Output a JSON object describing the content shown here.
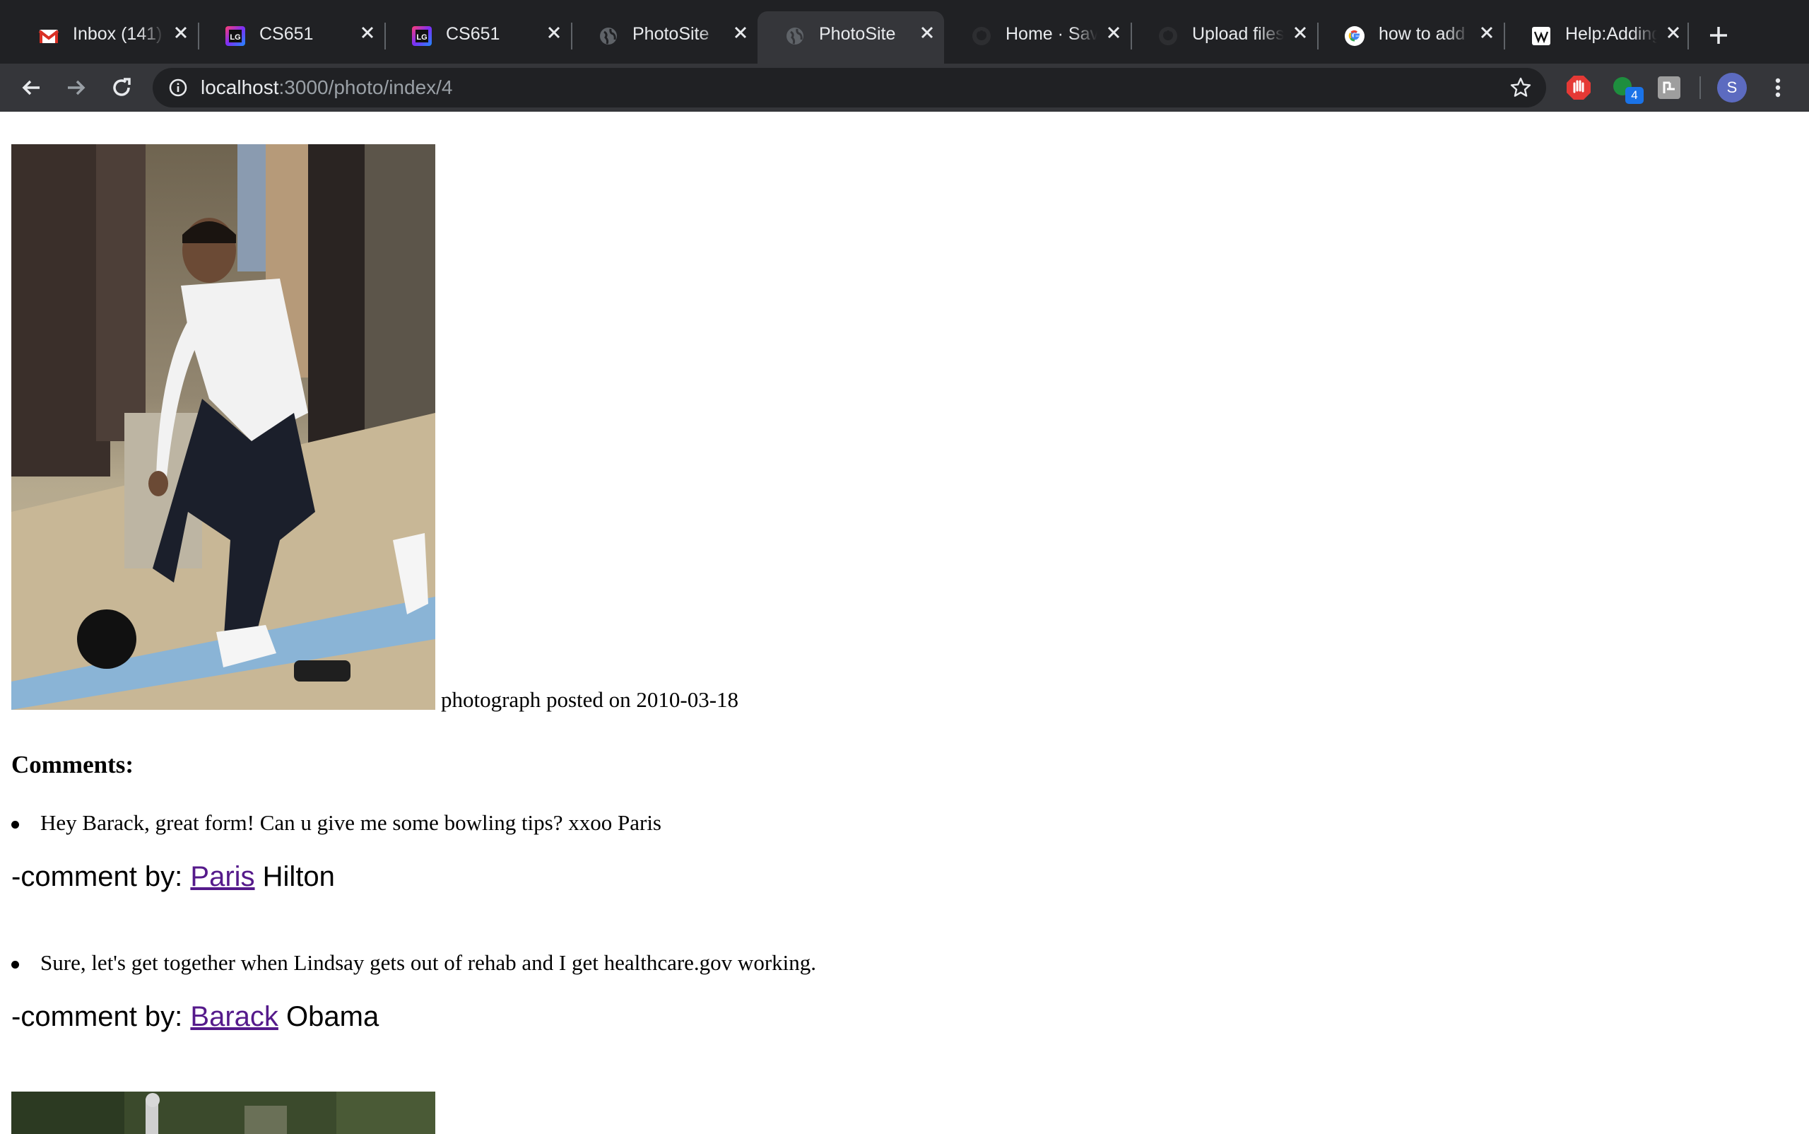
{
  "tabs": [
    {
      "title": "Inbox (141)",
      "icon": "gmail-icon",
      "active": false
    },
    {
      "title": "CS651",
      "icon": "lg-icon",
      "active": false
    },
    {
      "title": "CS651",
      "icon": "lg-icon",
      "active": false
    },
    {
      "title": "PhotoSite",
      "icon": "globe-icon",
      "active": false
    },
    {
      "title": "PhotoSite",
      "icon": "globe-icon",
      "active": true
    },
    {
      "title": "Home · Savi",
      "icon": "github-icon",
      "active": false
    },
    {
      "title": "Upload files",
      "icon": "github-icon",
      "active": false
    },
    {
      "title": "how to add",
      "icon": "google-icon",
      "active": false
    },
    {
      "title": "Help:Adding",
      "icon": "wikipedia-icon",
      "active": false
    }
  ],
  "toolbar": {
    "url_host": "localhost",
    "url_path": ":3000/photo/index/4",
    "extension_badge": "4",
    "avatar_letter": "S"
  },
  "page": {
    "caption": "photograph posted on 2010-03-18",
    "comments_heading": "Comments:",
    "comments": [
      {
        "text": "Hey Barack, great form! Can u give me some bowling tips? xxoo Paris",
        "by_prefix": "-comment by: ",
        "first_name": "Paris",
        "last_name": " Hilton"
      },
      {
        "text": "Sure, let's get together when Lindsay gets out of rehab and I get healthcare.gov working.",
        "by_prefix": "-comment by: ",
        "first_name": "Barack",
        "last_name": " Obama"
      }
    ]
  },
  "colors": {
    "tabstrip": "#202124",
    "toolbar": "#35363a",
    "link_visited": "#551a8b"
  }
}
